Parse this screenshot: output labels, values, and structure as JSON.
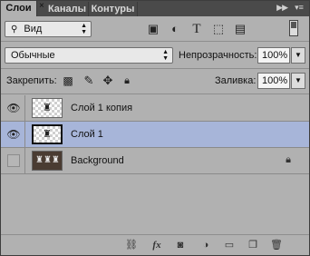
{
  "tabs": [
    {
      "label": "Слои",
      "active": true
    },
    {
      "label": "Каналы",
      "active": false
    },
    {
      "label": "Контуры",
      "active": false
    }
  ],
  "filter": {
    "label": "Вид"
  },
  "blend_mode": {
    "value": "Обычные"
  },
  "opacity": {
    "label": "Непрозрачность:",
    "value": "100%"
  },
  "lock": {
    "label": "Закрепить:"
  },
  "fill": {
    "label": "Заливка:",
    "value": "100%"
  },
  "layers": [
    {
      "name": "Слой 1 копия",
      "visible": true,
      "selected": false,
      "locked": false
    },
    {
      "name": "Слой 1",
      "visible": true,
      "selected": true,
      "locked": false
    },
    {
      "name": "Background",
      "visible": false,
      "selected": false,
      "locked": true
    }
  ],
  "colors": {
    "panel_bg": "#b1b1b1",
    "selected_layer": "#a7b5d9",
    "tabbar": "#4a4a4a"
  },
  "icons": {
    "filter_icons": [
      "image-filter-icon",
      "adjustment-filter-icon",
      "type-filter-icon",
      "shape-filter-icon",
      "smart-object-filter-icon"
    ],
    "lock_icons": [
      "lock-transparent-icon",
      "lock-image-icon",
      "lock-position-icon",
      "lock-all-icon"
    ],
    "footer_icons": [
      "link-layers-icon",
      "fx-icon",
      "add-mask-icon",
      "new-adjustment-icon",
      "new-group-icon",
      "new-layer-icon",
      "delete-layer-icon"
    ]
  }
}
